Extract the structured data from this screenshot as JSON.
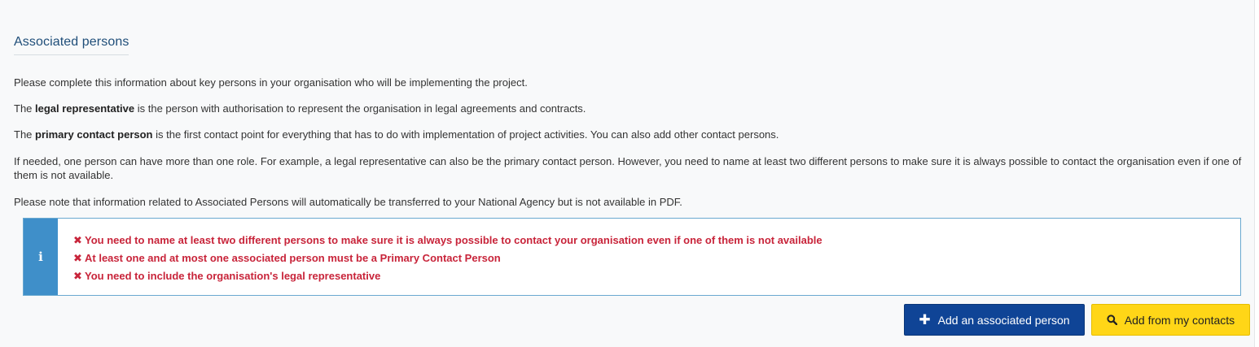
{
  "section": {
    "title": "Associated persons"
  },
  "intro": {
    "p1": "Please complete this information about key persons in your organisation who will be implementing the project.",
    "p2_bold": "legal representative",
    "p2_prefix": "The ",
    "p2_rest": " is the person with authorisation to represent the organisation in legal agreements and contracts.",
    "p3_prefix": "The ",
    "p3_bold": "primary contact person",
    "p3_rest": " is the first contact point for everything that has to do with implementation of project activities. You can also add other contact persons.",
    "p4": "If needed, one person can have more than one role. For example, a legal representative can also be the primary contact person. However, you need to name at least two different persons to make sure it is always possible to contact the organisation even if one of them is not available.",
    "p5": "Please note that information related to Associated Persons will automatically be transferred to your National Agency but is not available in PDF."
  },
  "alert": {
    "icon": "info-icon",
    "error_icon": "x-icon",
    "errors": [
      "You need to name at least two different persons to make sure it is always possible to contact your organisation even if one of them is not available",
      "At least one and at most one associated person must be a Primary Contact Person",
      "You need to include the organisation's legal representative"
    ],
    "colors": {
      "border": "#6aa9d0",
      "strip": "#3f8fc9",
      "error_text": "#c8243a"
    }
  },
  "actions": {
    "add_person": {
      "label": "Add an associated person",
      "icon": "plus-icon",
      "color": "#0f4496"
    },
    "add_from_contacts": {
      "label": "Add from my contacts",
      "icon": "search-icon",
      "color": "#ffd617"
    }
  }
}
